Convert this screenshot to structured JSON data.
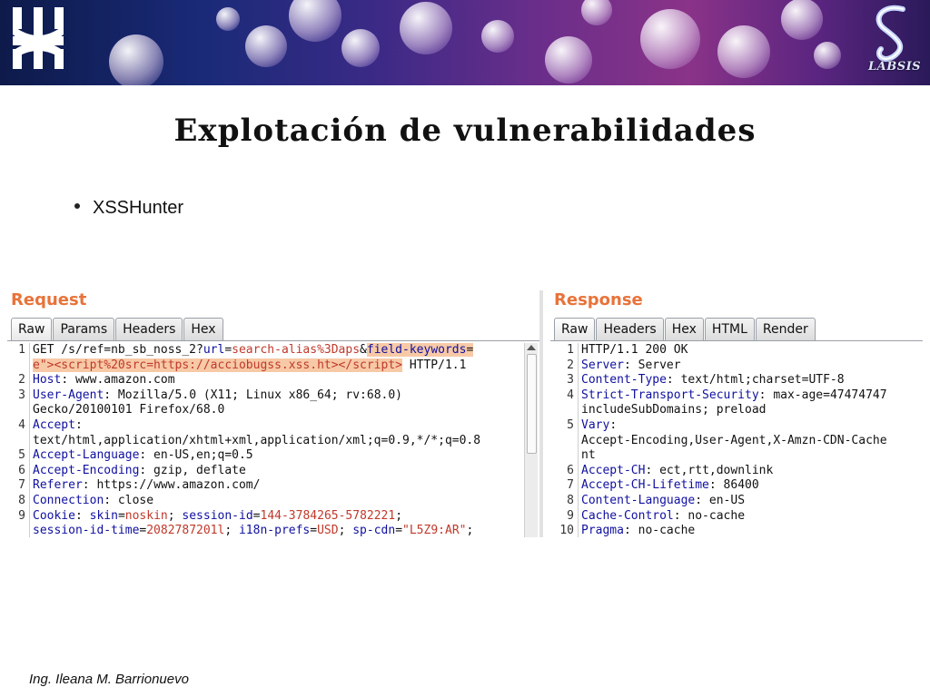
{
  "slide": {
    "title": "Explotación de vulnerabilidades",
    "bullet": "XSSHunter",
    "footer": "Ing. Ileana M. Barrionuevo",
    "labsis_logo_text": "LABSIS"
  },
  "request": {
    "title": "Request",
    "tabs": [
      "Raw",
      "Params",
      "Headers",
      "Hex"
    ],
    "active_tab": "Raw"
  },
  "response": {
    "title": "Response",
    "tabs": [
      "Raw",
      "Headers",
      "Hex",
      "HTML",
      "Render"
    ],
    "active_tab": "Raw"
  },
  "colors": {
    "accent": "#e8733a",
    "header_key": "#1010a0",
    "value": "#c0392b",
    "highlight": "#f7c9a6"
  }
}
